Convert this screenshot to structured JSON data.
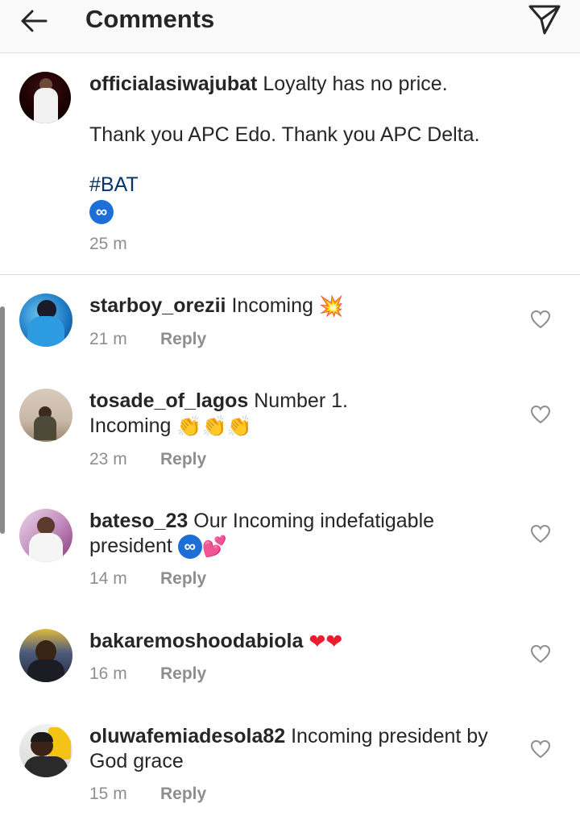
{
  "header": {
    "title": "Comments",
    "back_icon": "arrow-left-icon",
    "send_icon": "paper-plane-icon"
  },
  "caption": {
    "username": "officialasiwajubat",
    "text_line1": "Loyalty has no price.",
    "text_line2": "Thank you APC Edo. Thank you APC Delta.",
    "hashtag": "#BAT",
    "emoji": "∞",
    "time": "25 m"
  },
  "comments": [
    {
      "username": "starboy_orezii",
      "text": "Incoming",
      "emoji": "💥",
      "time": "21 m",
      "reply": "Reply"
    },
    {
      "username": "tosade_of_lagos",
      "text": "Number 1.",
      "text_line2": "Incoming",
      "emoji": "👏👏👏",
      "time": "23 m",
      "reply": "Reply"
    },
    {
      "username": "bateso_23",
      "text": "Our Incoming indefatigable",
      "text_line2": "president",
      "emoji": "∞",
      "emoji2": "💕",
      "time": "14 m",
      "reply": "Reply"
    },
    {
      "username": "bakaremoshoodabiola",
      "text": "",
      "emoji": "❤❤",
      "time": "16 m",
      "reply": "Reply"
    },
    {
      "username": "oluwafemiadesola82",
      "text": "Incoming president by",
      "text_line2": "God grace",
      "time": "15 m",
      "reply": "Reply"
    }
  ],
  "colors": {
    "link": "#00376b",
    "meta": "#8e8e8e",
    "text": "#262626",
    "heart_red": "#ed1b2e"
  }
}
